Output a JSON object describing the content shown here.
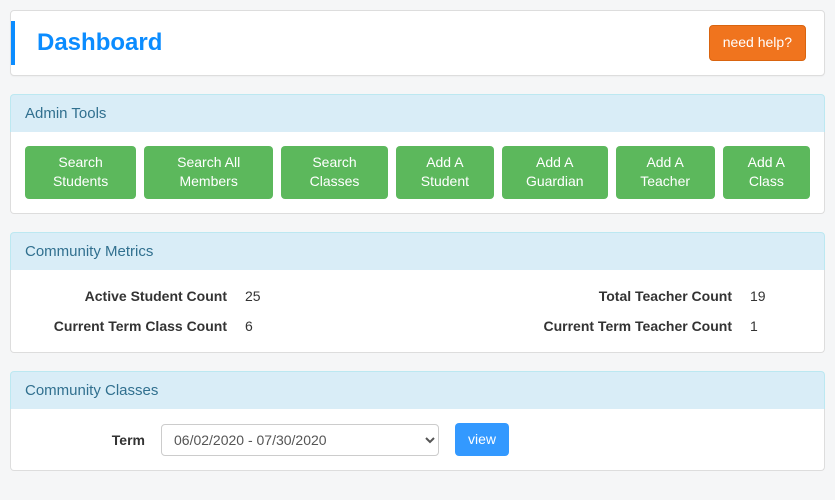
{
  "header": {
    "title": "Dashboard",
    "help_label": "need help?"
  },
  "admin_tools": {
    "heading": "Admin Tools",
    "search_buttons": [
      "Search Students",
      "Search All Members",
      "Search Classes"
    ],
    "add_buttons": [
      "Add A Student",
      "Add A Guardian",
      "Add A Teacher",
      "Add A Class"
    ]
  },
  "community_metrics": {
    "heading": "Community Metrics",
    "metrics": {
      "active_student_count_label": "Active Student Count",
      "active_student_count_value": "25",
      "total_teacher_count_label": "Total Teacher Count",
      "total_teacher_count_value": "19",
      "current_term_class_count_label": "Current Term Class Count",
      "current_term_class_count_value": "6",
      "current_term_teacher_count_label": "Current Term Teacher Count",
      "current_term_teacher_count_value": "1"
    }
  },
  "community_classes": {
    "heading": "Community Classes",
    "term_label": "Term",
    "term_selected": "06/02/2020 - 07/30/2020",
    "view_label": "view"
  }
}
